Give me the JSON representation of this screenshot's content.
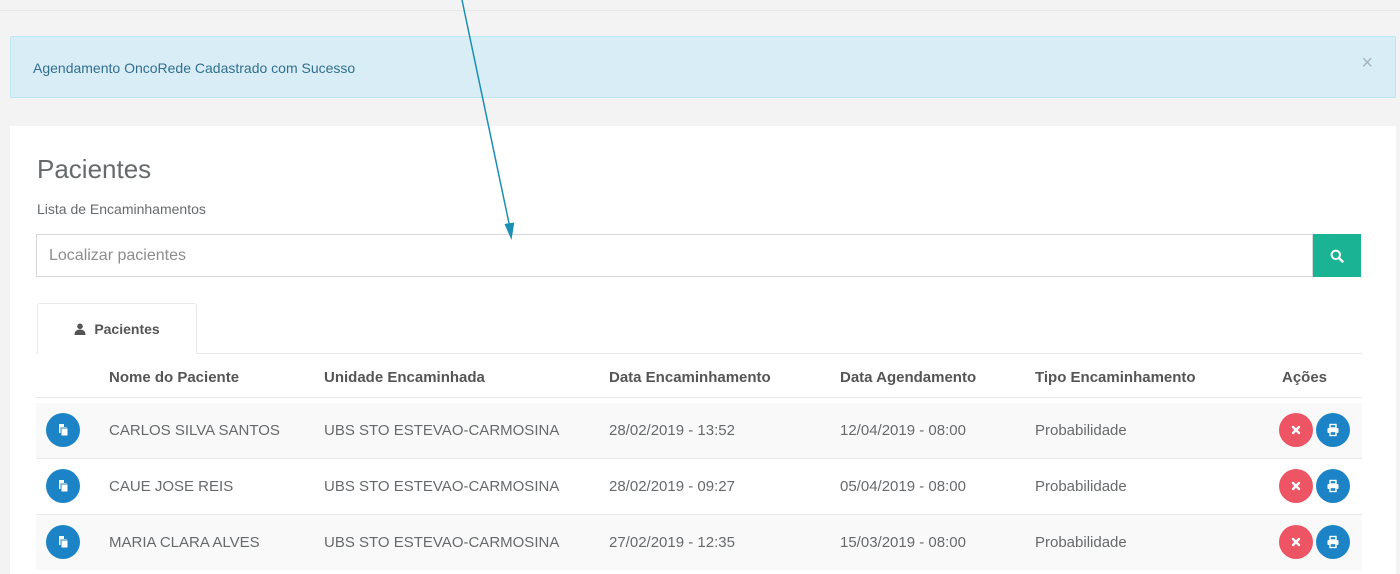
{
  "alert": {
    "message": "Agendamento OncoRede Cadastrado com Sucesso",
    "close": "×"
  },
  "page": {
    "title": "Pacientes",
    "subtitle": "Lista de Encaminhamentos"
  },
  "search": {
    "placeholder": "Localizar pacientes",
    "value": "",
    "button_icon": "search-icon"
  },
  "tabs": [
    {
      "label": "Pacientes",
      "icon": "user-icon",
      "active": true
    }
  ],
  "table": {
    "headers": [
      "Nome do Paciente",
      "Unidade Encaminhada",
      "Data Encaminhamento",
      "Data Agendamento",
      "Tipo Encaminhamento",
      "Ações"
    ],
    "rows": [
      {
        "name": "CARLOS SILVA SANTOS",
        "unit": "UBS STO ESTEVAO-CARMOSINA",
        "referral_date": "28/02/2019 - 13:52",
        "schedule_date": "12/04/2019 - 08:00",
        "type": "Probabilidade"
      },
      {
        "name": "CAUE JOSE REIS",
        "unit": "UBS STO ESTEVAO-CARMOSINA",
        "referral_date": "28/02/2019 - 09:27",
        "schedule_date": "05/04/2019 - 08:00",
        "type": "Probabilidade"
      },
      {
        "name": "MARIA CLARA ALVES",
        "unit": "UBS STO ESTEVAO-CARMOSINA",
        "referral_date": "27/02/2019 - 12:35",
        "schedule_date": "15/03/2019 - 08:00",
        "type": "Probabilidade"
      }
    ],
    "row_icons": {
      "open": "copy-icon",
      "delete": "close-icon",
      "print": "print-icon"
    }
  },
  "colors": {
    "alert_bg": "#d9edf7",
    "search_button": "#1ab394",
    "primary_blue": "#1c84c6",
    "danger_red": "#ed5565",
    "annotation_arrow": "#1b8fb3"
  }
}
